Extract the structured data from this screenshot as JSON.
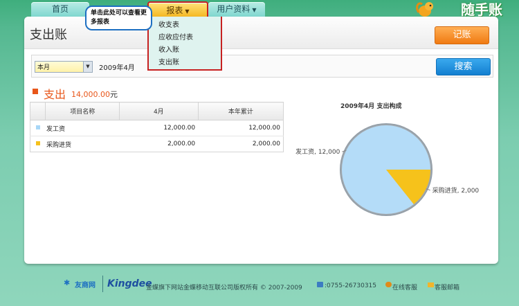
{
  "nav": {
    "tabs": [
      {
        "label": "首页"
      },
      {
        "label": "报表"
      },
      {
        "label": "用户资料"
      }
    ],
    "logo_text": "随手账"
  },
  "tooltip": "单击此处可以查看更多报表",
  "report_menu": [
    "收支表",
    "应收应付表",
    "收入账",
    "支出账"
  ],
  "page": {
    "title": "支出账",
    "record_button": "记账",
    "period_select": "本月",
    "period_text": "2009年4月",
    "search_button": "搜索"
  },
  "summary": {
    "label": "支出",
    "amount": "14,000.00",
    "unit": "元"
  },
  "table": {
    "headers": [
      "项目名称",
      "4月",
      "本年累计"
    ],
    "rows": [
      {
        "name": "发工资",
        "month": "12,000.00",
        "ytd": "12,000.00",
        "color": "#a8d7f7"
      },
      {
        "name": "采购进货",
        "month": "2,000.00",
        "ytd": "2,000.00",
        "color": "#f5c11d"
      }
    ]
  },
  "chart_data": {
    "type": "pie",
    "title": "2009年4月  支出构成",
    "slices": [
      {
        "label": "发工资",
        "value": 12000,
        "color": "#b4dcf8"
      },
      {
        "label": "采购进货",
        "value": 2000,
        "color": "#f6c21b"
      }
    ],
    "slice_labels": [
      "发工资, 12,000",
      "采购进货, 2,000"
    ]
  },
  "footer": {
    "brand1": "友商网",
    "brand2": "Kingdee",
    "copyright": "金蝶旗下网站金蝶移动互联公司版权所有 © 2007-2009",
    "phone": "0755-26730315",
    "service": "在线客服",
    "mail": "客服邮箱"
  }
}
